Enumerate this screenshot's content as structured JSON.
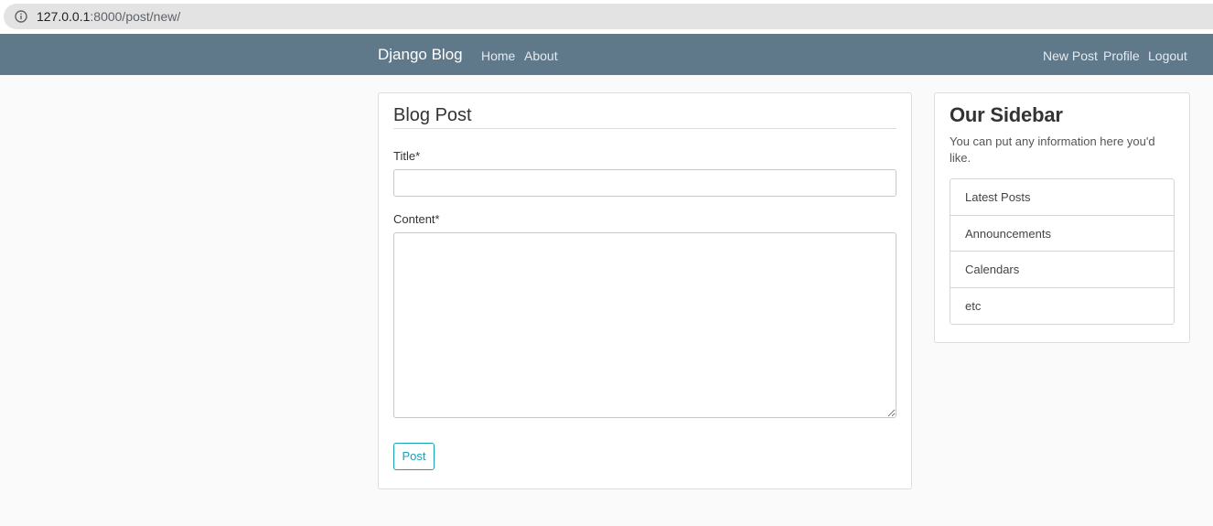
{
  "browser": {
    "url_host": "127.0.0.1",
    "url_rest": ":8000/post/new/",
    "info_icon": "info-icon"
  },
  "navbar": {
    "brand": "Django Blog",
    "left_links": [
      "Home",
      "About"
    ],
    "right_links": [
      "New Post",
      "Profile",
      "Logout"
    ],
    "background": "#5f788a"
  },
  "form": {
    "legend": "Blog Post",
    "title_label": "Title",
    "content_label": "Content",
    "required_marker": "*",
    "title_value": "",
    "content_value": "",
    "submit_label": "Post",
    "accent": "#17a2b8"
  },
  "sidebar": {
    "title": "Our Sidebar",
    "description": "You can put any information here you'd like.",
    "items": [
      "Latest Posts",
      "Announcements",
      "Calendars",
      "etc"
    ]
  }
}
